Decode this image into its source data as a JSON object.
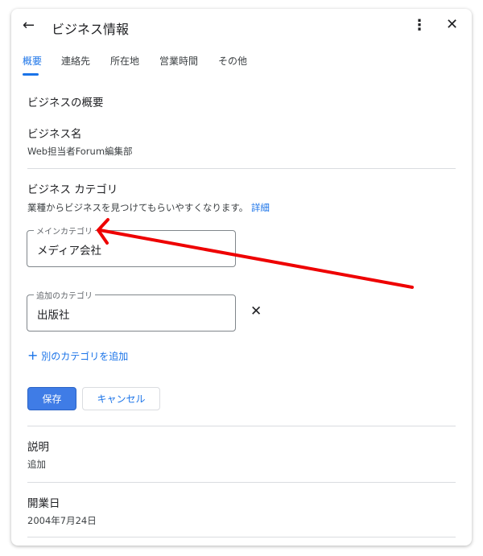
{
  "header": {
    "title": "ビジネス情報"
  },
  "tabs": [
    {
      "label": "概要"
    },
    {
      "label": "連絡先"
    },
    {
      "label": "所在地"
    },
    {
      "label": "営業時間"
    },
    {
      "label": "その他"
    }
  ],
  "overview": {
    "section_title": "ビジネスの概要",
    "name_label": "ビジネス名",
    "name_value": "Web担当者Forum編集部"
  },
  "category": {
    "title": "ビジネス カテゴリ",
    "description": "業種からビジネスを見つけてもらいやすくなります。",
    "details_link": "詳細",
    "main_label": "メインカテゴリ",
    "main_value": "メディア会社",
    "extra_label": "追加のカテゴリ",
    "extra_value": "出版社",
    "add_link": "別のカテゴリを追加",
    "save": "保存",
    "cancel": "キャンセル"
  },
  "description": {
    "label": "説明",
    "value": "追加"
  },
  "opening": {
    "label": "開業日",
    "value": "2004年7月24日"
  },
  "annotation_color": "#ee0000"
}
